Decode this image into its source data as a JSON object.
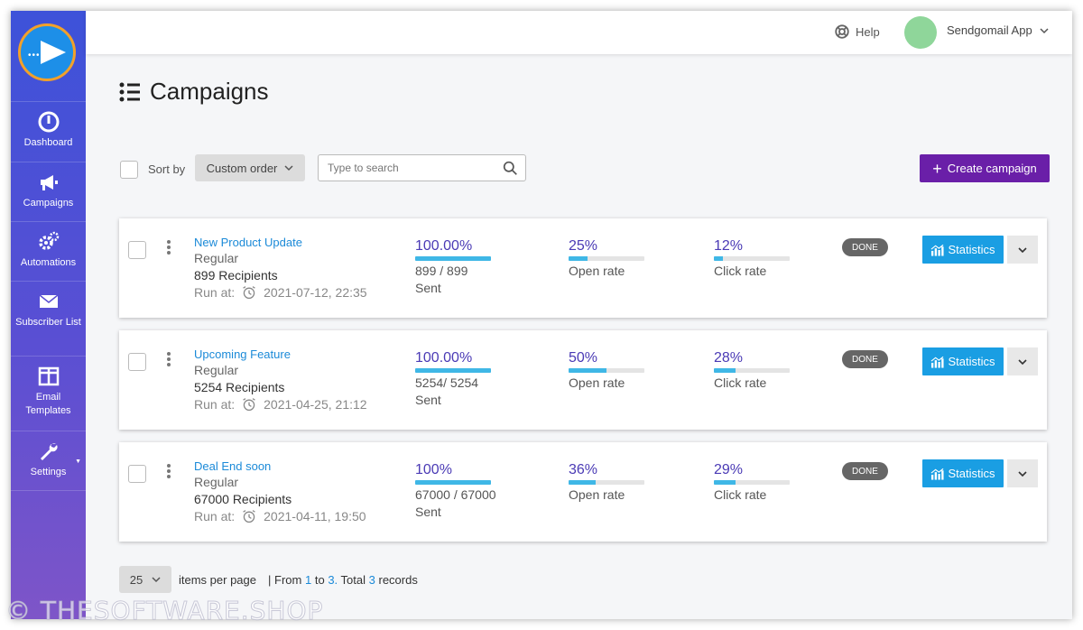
{
  "topbar": {
    "help_label": "Help",
    "user_name": "Sendgomail App"
  },
  "sidebar": {
    "items": [
      {
        "label": "Dashboard",
        "icon": "dashboard-icon"
      },
      {
        "label": "Campaigns",
        "icon": "megaphone-icon"
      },
      {
        "label": "Automations",
        "icon": "gears-icon"
      },
      {
        "label": "Subscriber List",
        "icon": "envelope-icon"
      },
      {
        "label": "Email Templates",
        "icon": "template-icon"
      },
      {
        "label": "Settings",
        "icon": "wrench-icon"
      }
    ]
  },
  "page": {
    "title": "Campaigns"
  },
  "toolbar": {
    "sort_label": "Sort by",
    "sort_value": "Custom order",
    "search_placeholder": "Type to search",
    "create_label": "Create campaign"
  },
  "campaigns": [
    {
      "name": "New Product Update",
      "type": "Regular",
      "recipients": "899 Recipients",
      "run_label": "Run at:",
      "run_at": "2021-07-12, 22:35",
      "sent_pct_text": "100.00%",
      "sent_pct": 100,
      "sent_count": "899 / 899",
      "sent_label": "Sent",
      "open_text": "25%",
      "open_pct": 25,
      "open_label": "Open rate",
      "click_text": "12%",
      "click_pct": 12,
      "click_label": "Click rate",
      "status": "DONE",
      "stats_label": "Statistics"
    },
    {
      "name": "Upcoming Feature",
      "type": "Regular",
      "recipients": "5254 Recipients",
      "run_label": "Run at:",
      "run_at": "2021-04-25, 21:12",
      "sent_pct_text": "100.00%",
      "sent_pct": 100,
      "sent_count": "5254/ 5254",
      "sent_label": "Sent",
      "open_text": "50%",
      "open_pct": 50,
      "open_label": "Open rate",
      "click_text": "28%",
      "click_pct": 28,
      "click_label": "Click rate",
      "status": "DONE",
      "stats_label": "Statistics"
    },
    {
      "name": "Deal End soon",
      "type": "Regular",
      "recipients": "67000 Recipients",
      "run_label": "Run at:",
      "run_at": "2021-04-11, 19:50",
      "sent_pct_text": "100%",
      "sent_pct": 100,
      "sent_count": "67000 / 67000",
      "sent_label": "Sent",
      "open_text": "36%",
      "open_pct": 36,
      "open_label": "Open rate",
      "click_text": "29%",
      "click_pct": 29,
      "click_label": "Click rate",
      "status": "DONE",
      "stats_label": "Statistics"
    }
  ],
  "pagination": {
    "per_page": "25",
    "per_page_label": "items per page",
    "sep": "|",
    "from_label": "From",
    "from": "1",
    "to_label": "to",
    "to": "3.",
    "total_label": "Total",
    "total": "3",
    "records_label": "records"
  },
  "watermark": "© THESOFTWARE.SHOP",
  "colors": {
    "sidebar_top": "#3d52d9",
    "sidebar_bottom": "#7e55c8",
    "primary_purple": "#6a1fa8",
    "stats_blue": "#1a9ee3",
    "link_blue": "#1b8ad8",
    "progress": "#3fb7e6"
  }
}
